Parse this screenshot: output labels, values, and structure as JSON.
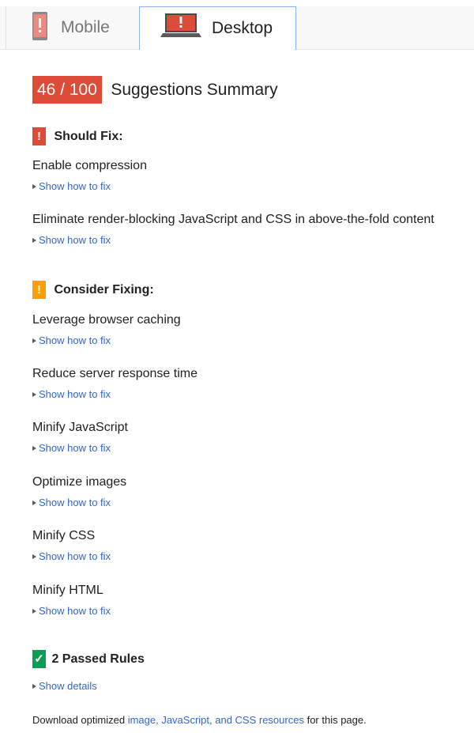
{
  "tabs": [
    {
      "label": "Mobile",
      "icon": "phone-warning-icon",
      "active": false
    },
    {
      "label": "Desktop",
      "icon": "laptop-warning-icon",
      "active": true
    }
  ],
  "score": {
    "value": "46 / 100",
    "title": "Suggestions Summary",
    "color": "#dd4b39"
  },
  "should_fix": {
    "icon": "!",
    "title": "Should Fix:",
    "color": "#dd4b39",
    "rules": [
      {
        "name": "Enable compression",
        "link": "Show how to fix"
      },
      {
        "name": "Eliminate render-blocking JavaScript and CSS in above-the-fold content",
        "link": "Show how to fix"
      }
    ]
  },
  "consider_fixing": {
    "icon": "!",
    "title": "Consider Fixing:",
    "color": "#ff9e00",
    "rules": [
      {
        "name": "Leverage browser caching",
        "link": "Show how to fix"
      },
      {
        "name": "Reduce server response time",
        "link": "Show how to fix"
      },
      {
        "name": "Minify JavaScript",
        "link": "Show how to fix"
      },
      {
        "name": "Optimize images",
        "link": "Show how to fix"
      },
      {
        "name": "Minify CSS",
        "link": "Show how to fix"
      },
      {
        "name": "Minify HTML",
        "link": "Show how to fix"
      }
    ]
  },
  "passed": {
    "icon": "✓",
    "title": "2 Passed Rules",
    "color": "#0b9d58",
    "link": "Show details"
  },
  "footer": {
    "prefix": "Download optimized ",
    "link": "image, JavaScript, and CSS resources",
    "suffix": " for this page."
  }
}
